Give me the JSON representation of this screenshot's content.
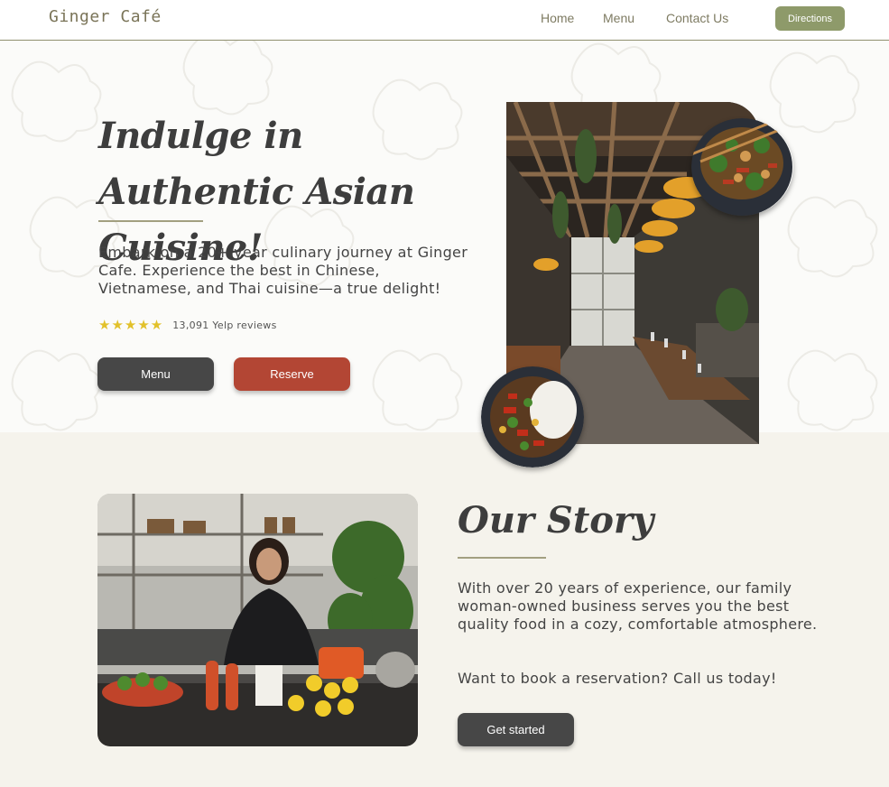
{
  "nav": {
    "brand": "Ginger Café",
    "links": [
      "Home",
      "Menu",
      "Contact Us"
    ],
    "directions_label": "Directions"
  },
  "hero": {
    "title": "Indulge in Authentic Asian Cuisine!",
    "description": "Embark on a 20+ year culinary journey at Ginger Cafe. Experience the best in Chinese, Vietnamese, and Thai cuisine—a true delight!",
    "rating_stars": 5,
    "stars_text": "★★★★★",
    "reviews_text": "13,091 Yelp reviews",
    "menu_button": "Menu",
    "reserve_button": "Reserve"
  },
  "story": {
    "title": "Our Story",
    "text": "With over 20 years of experience, our family woman-owned business serves you the best quality food in a cozy, comfortable atmosphere.",
    "cta_text": "Want to book a reservation? Call us today!",
    "button": "Get started"
  },
  "colors": {
    "brand": "#7a7458",
    "accent_olive": "#8e9a6a",
    "button_dark": "#474747",
    "button_red": "#b34634",
    "star": "#e2c12a",
    "page_bg": "#f5f3ec"
  }
}
